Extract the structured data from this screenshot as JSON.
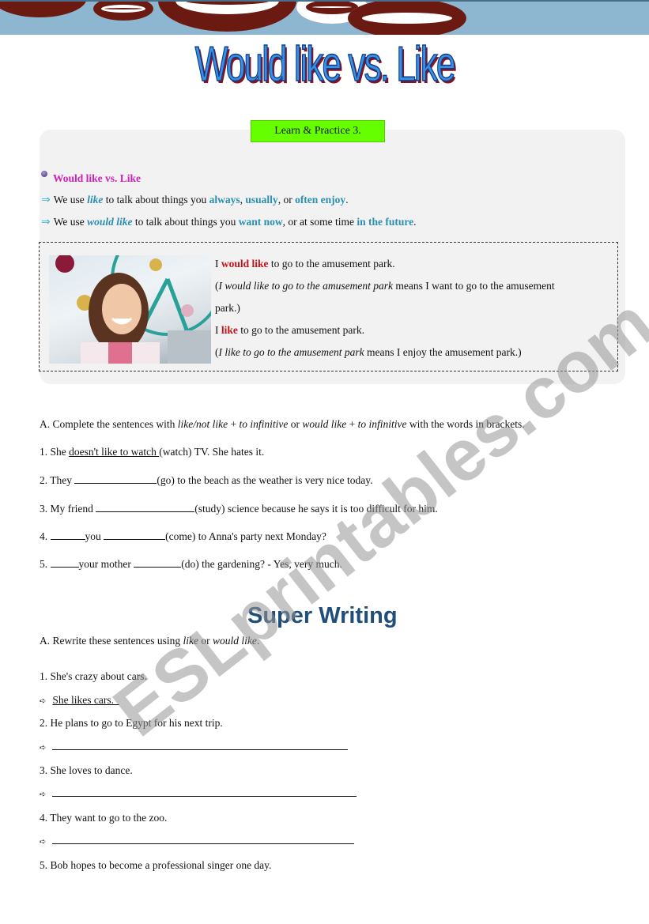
{
  "header": {
    "title": "Would like vs. Like",
    "section_badge": "Learn & Practice 3."
  },
  "grammar": {
    "heading": "Would like vs. Like",
    "rule1": {
      "pre": "We use ",
      "key": "like",
      "mid": " to talk about things you ",
      "w1": "always",
      "sep1": ", ",
      "w2": "usually",
      "sep2": ", or ",
      "w3": "often enjoy",
      "end": "."
    },
    "rule2": {
      "pre": "We use ",
      "key": "would like",
      "mid": " to talk about things you ",
      "w1": "want now",
      "sep1": ", or at some time ",
      "w2": "in the future",
      "end": "."
    },
    "examples": {
      "e1_pre": "I ",
      "e1_key": "would like",
      "e1_post": " to go to the amusement park.",
      "e2_italic": "I would like to go to the amusement park",
      "e2_rest": " means I want to go to the amusement",
      "e2_cont": "park.)",
      "e3_pre": "I ",
      "e3_key": "like",
      "e3_post": " to go to the amusement park.",
      "e4_italic": "I like to go to the amusement park",
      "e4_rest": " means I enjoy the amusement park.)"
    },
    "photo_alt": "woman smiling at amusement park"
  },
  "exercise_a": {
    "instr_pre": "A. Complete the sentences with ",
    "instr_i1": "like/not like",
    "instr_plus1": " + ",
    "instr_i2": "to infinitive",
    "instr_or": " or ",
    "instr_i3": "would like",
    "instr_plus2": " + ",
    "instr_i4": "to infinitive",
    "instr_post": " with the words in brackets.",
    "q1_pre": "1. She ",
    "q1_answer": "doesn't like to watch ",
    "q1_post": "(watch) TV. She hates it.",
    "q2_pre": "2. They ",
    "q2_post": "(go) to the beach as the weather is very nice today.",
    "q3_pre": "3. My friend ",
    "q3_post": "(study) science because he says it is too difficult for him.",
    "q4_pre": "4. ",
    "q4_mid": "you ",
    "q4_post": "(come) to Anna's party next Monday?",
    "q5_pre": "5. ",
    "q5_mid": "your mother ",
    "q5_post": "(do) the gardening? - Yes, very much."
  },
  "super_writing": {
    "title": "Super Writing",
    "instr_pre": "A. Rewrite these sentences using ",
    "instr_i1": "like",
    "instr_or": " or ",
    "instr_i2": "would like",
    "instr_post": ".",
    "items": [
      {
        "prompt": "1. She's crazy about cars.",
        "answer": "She likes cars.  "
      },
      {
        "prompt": "2. He plans to go to Egypt for his next trip.",
        "answer": ""
      },
      {
        "prompt": "3. She loves to dance.",
        "answer": ""
      },
      {
        "prompt": "4. They want to go to the zoo.",
        "answer": ""
      },
      {
        "prompt": "5. Bob hopes to become a professional singer one day.",
        "answer": ""
      }
    ]
  },
  "watermark": "ESLprintables.com"
}
